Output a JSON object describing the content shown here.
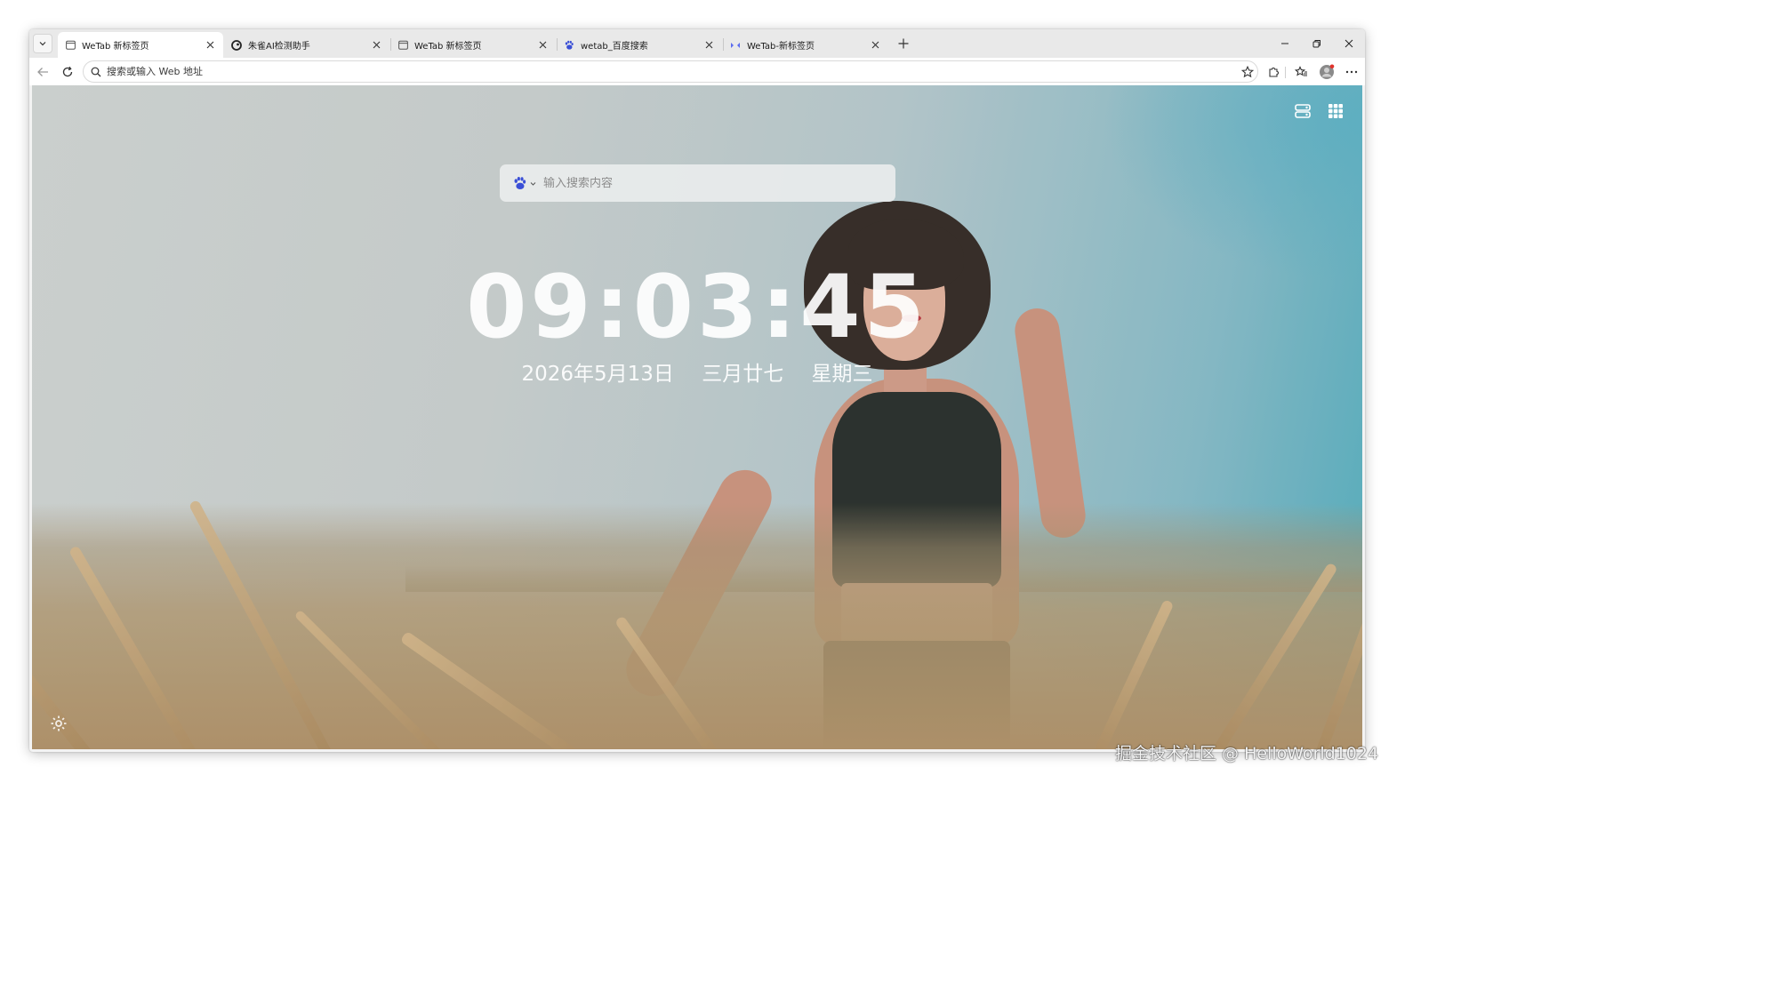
{
  "browser": {
    "tabs": [
      {
        "title": "WeTab 新标签页",
        "favicon": "wetab-page-icon",
        "active": true
      },
      {
        "title": "朱雀AI检测助手",
        "favicon": "zhuque-icon",
        "active": false
      },
      {
        "title": "WeTab 新标签页",
        "favicon": "wetab-page-icon",
        "active": false
      },
      {
        "title": "wetab_百度搜索",
        "favicon": "baidu-paw-icon",
        "active": false
      },
      {
        "title": "WeTab-新标签页",
        "favicon": "wetab-logo-icon",
        "active": false
      }
    ],
    "address_placeholder": "搜索或输入 Web 地址"
  },
  "page": {
    "search_placeholder": "输入搜索内容",
    "search_engine": "baidu-paw-icon",
    "time": "09:03:45",
    "date": {
      "gregorian": "2026年5月13日",
      "lunar": "三月廿七",
      "weekday": "星期三"
    }
  },
  "watermark": "掘金技术社区 @ HelloWorld1024",
  "colors": {
    "baidu_blue": "#3a4fd6",
    "tab_strip": "#e9e9e9",
    "sky_teal": "#4aa6b6"
  }
}
